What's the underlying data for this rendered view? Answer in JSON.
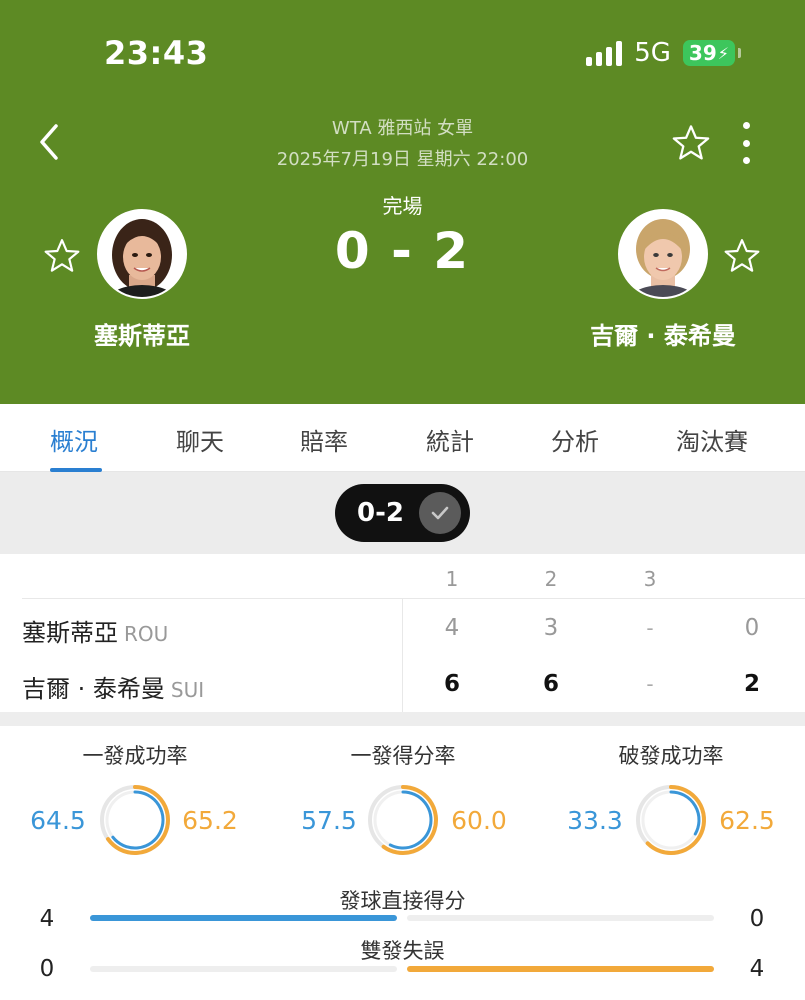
{
  "status_bar": {
    "time": "23:43",
    "network": "5G",
    "battery": "39"
  },
  "header": {
    "event": "WTA 雅西站 女單",
    "datetime": "2025年7月19日 星期六 22:00",
    "match_status": "完場",
    "score": "0 - 2",
    "player_left": {
      "name": "塞斯蒂亞"
    },
    "player_right": {
      "name": "吉爾 · 泰希曼"
    }
  },
  "tabs": [
    "概況",
    "聊天",
    "賠率",
    "統計",
    "分析",
    "淘汰賽"
  ],
  "active_tab": "概況",
  "pill": {
    "label": "0-2"
  },
  "scoreboard": {
    "set_headers": [
      "1",
      "2",
      "3"
    ],
    "rows": [
      {
        "name": "塞斯蒂亞",
        "country": "ROU",
        "sets": [
          "4",
          "3",
          "-"
        ],
        "total": "0"
      },
      {
        "name": "吉爾 · 泰希曼",
        "country": "SUI",
        "sets": [
          "6",
          "6",
          "-"
        ],
        "total": "2"
      }
    ]
  },
  "ring_stats": [
    {
      "title": "一發成功率",
      "left": "64.5",
      "right": "65.2"
    },
    {
      "title": "一發得分率",
      "left": "57.5",
      "right": "60.0"
    },
    {
      "title": "破發成功率",
      "left": "33.3",
      "right": "62.5"
    }
  ],
  "bar_stats": [
    {
      "title": "發球直接得分",
      "left": "4",
      "right": "0",
      "left_fraction": 1.0,
      "right_fraction": 0.0
    },
    {
      "title": "雙發失誤",
      "left": "0",
      "right": "4",
      "left_fraction": 0.0,
      "right_fraction": 1.0
    }
  ],
  "colors": {
    "header_green": "#5d8a24",
    "accent_blue": "#2a7fd1",
    "left_blue": "#3a96d8",
    "right_orange": "#f2a93a"
  }
}
